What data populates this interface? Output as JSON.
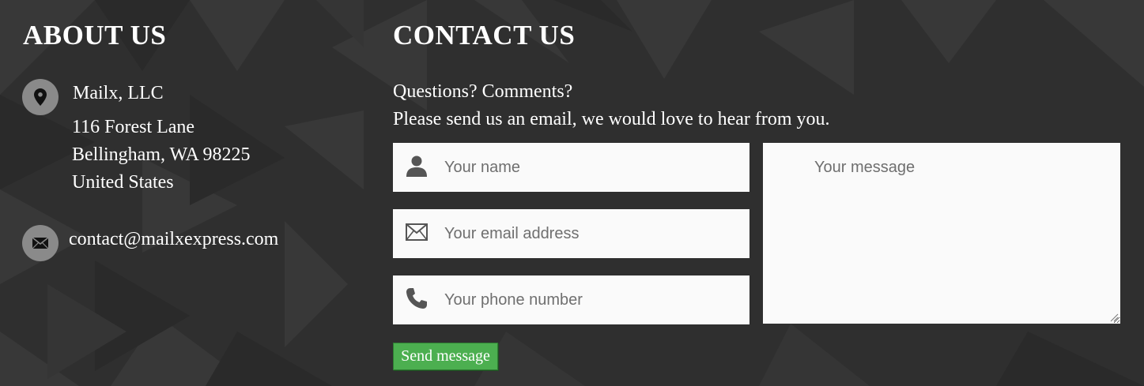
{
  "about": {
    "title": "ABOUT US",
    "location_icon": "map-pin-icon",
    "company": "Mailx, LLC",
    "address_line1": "116 Forest Lane",
    "address_line2": "Bellingham, WA 98225",
    "address_line3": "United States",
    "email_icon": "envelope-icon",
    "email": "contact@mailxexpress.com"
  },
  "contact": {
    "title": "CONTACT US",
    "intro_line1": "Questions? Comments?",
    "intro_line2": "Please send us an email, we would love to hear from you.",
    "name_placeholder": "Your name",
    "name_icon": "user-icon",
    "email_placeholder": "Your email address",
    "email_icon": "envelope-outline-icon",
    "phone_placeholder": "Your phone number",
    "phone_icon": "phone-icon",
    "message_placeholder": "Your message",
    "send_label": "Send message"
  },
  "colors": {
    "background": "#2f2f2f",
    "icon_circle": "#8a8a8a",
    "field_bg": "#fafafa",
    "button_green": "#4caf50",
    "text": "#ffffff"
  }
}
